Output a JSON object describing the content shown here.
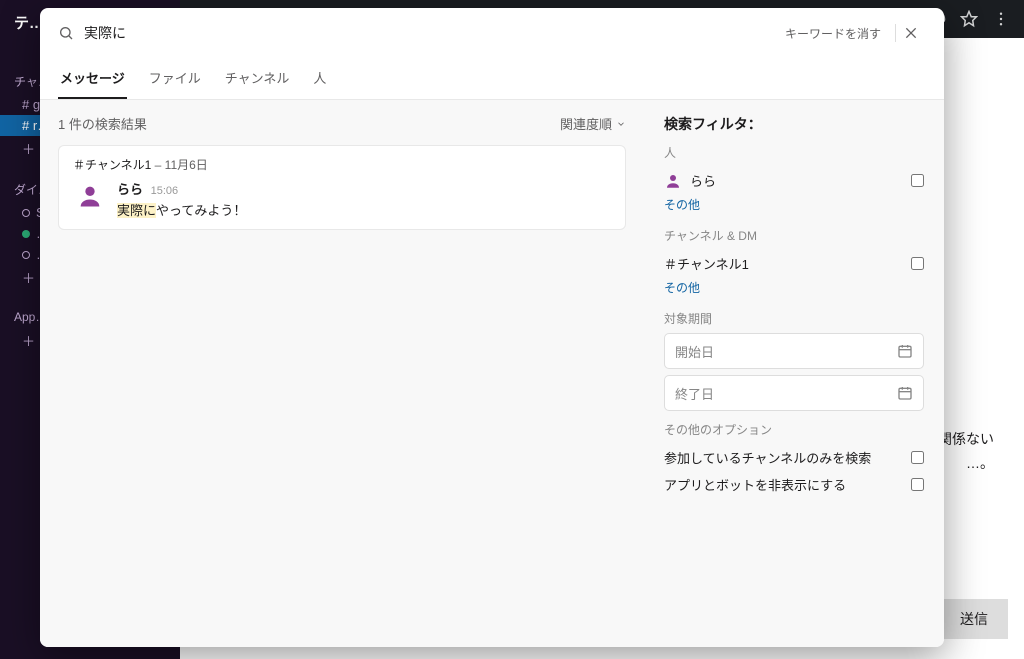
{
  "chrome": {
    "workspace_title": "テ…",
    "sections": {
      "channels_label": "チャ…",
      "channels": [
        {
          "name": "# g…",
          "active": false
        },
        {
          "name": "# r…",
          "active": true
        }
      ],
      "add_ch": "＋ …",
      "dm_label": "ダイ…",
      "dms": [
        {
          "name": "S…",
          "presence": "away"
        },
        {
          "name": "…",
          "presence": "on"
        },
        {
          "name": "…",
          "presence": "away"
        }
      ],
      "add_dm": "＋ …",
      "apps_label": "App…",
      "add_app": "＋ …"
    },
    "snippet_lines": [
      "…関係ない",
      "…。"
    ],
    "send_label": "送信"
  },
  "search": {
    "query": "実際に",
    "clear_label": "キーワードを消す",
    "tabs": [
      "メッセージ",
      "ファイル",
      "チャンネル",
      "人"
    ],
    "active_tab": 0,
    "results_count_label": "1 件の検索結果",
    "sort_label": "関連度順",
    "results": [
      {
        "channel": "＃チャンネル1",
        "sep": " – ",
        "date": "11月6日",
        "user": "らら",
        "time": "15:06",
        "msg_hl": "実際に",
        "msg_rest": "やってみよう！"
      }
    ],
    "filters": {
      "title": "検索フィルタ：",
      "people_label": "人",
      "people": [
        {
          "name": "らら"
        }
      ],
      "people_more": "その他",
      "channels_label": "チャンネル & DM",
      "channels": [
        {
          "name": "＃チャンネル1"
        }
      ],
      "channels_more": "その他",
      "period_label": "対象期間",
      "start_placeholder": "開始日",
      "end_placeholder": "終了日",
      "other_label": "その他のオプション",
      "opt1": "参加しているチャンネルのみを検索",
      "opt2": "アプリとボットを非表示にする"
    }
  }
}
